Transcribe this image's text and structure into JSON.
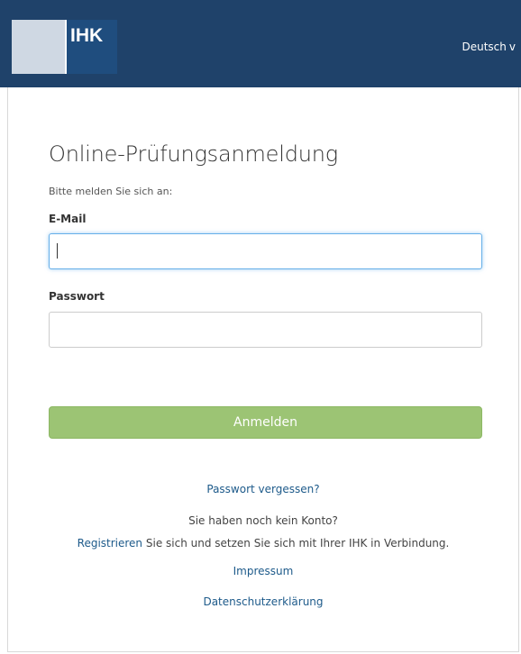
{
  "header": {
    "logo_text": "IHK",
    "language_label": "Deutsch",
    "language_chevron": "v",
    "background_color": "#1f426a"
  },
  "form": {
    "title": "Online-Prüfungsanmeldung",
    "subtitle": "Bitte melden Sie sich an:",
    "email_label": "E-Mail",
    "email_value": "",
    "password_label": "Passwort",
    "password_value": "",
    "submit_label": "Anmelden",
    "submit_color": "#9cc474"
  },
  "links": {
    "forgot_password": "Passwort vergessen?",
    "no_account_text": "Sie haben noch kein Konto?",
    "register_link": "Registrieren",
    "register_rest": " Sie sich und setzen Sie sich mit Ihrer IHK in Verbindung.",
    "impressum": "Impressum",
    "privacy": "Datenschutzerklärung",
    "link_color": "#1d5a8a"
  }
}
